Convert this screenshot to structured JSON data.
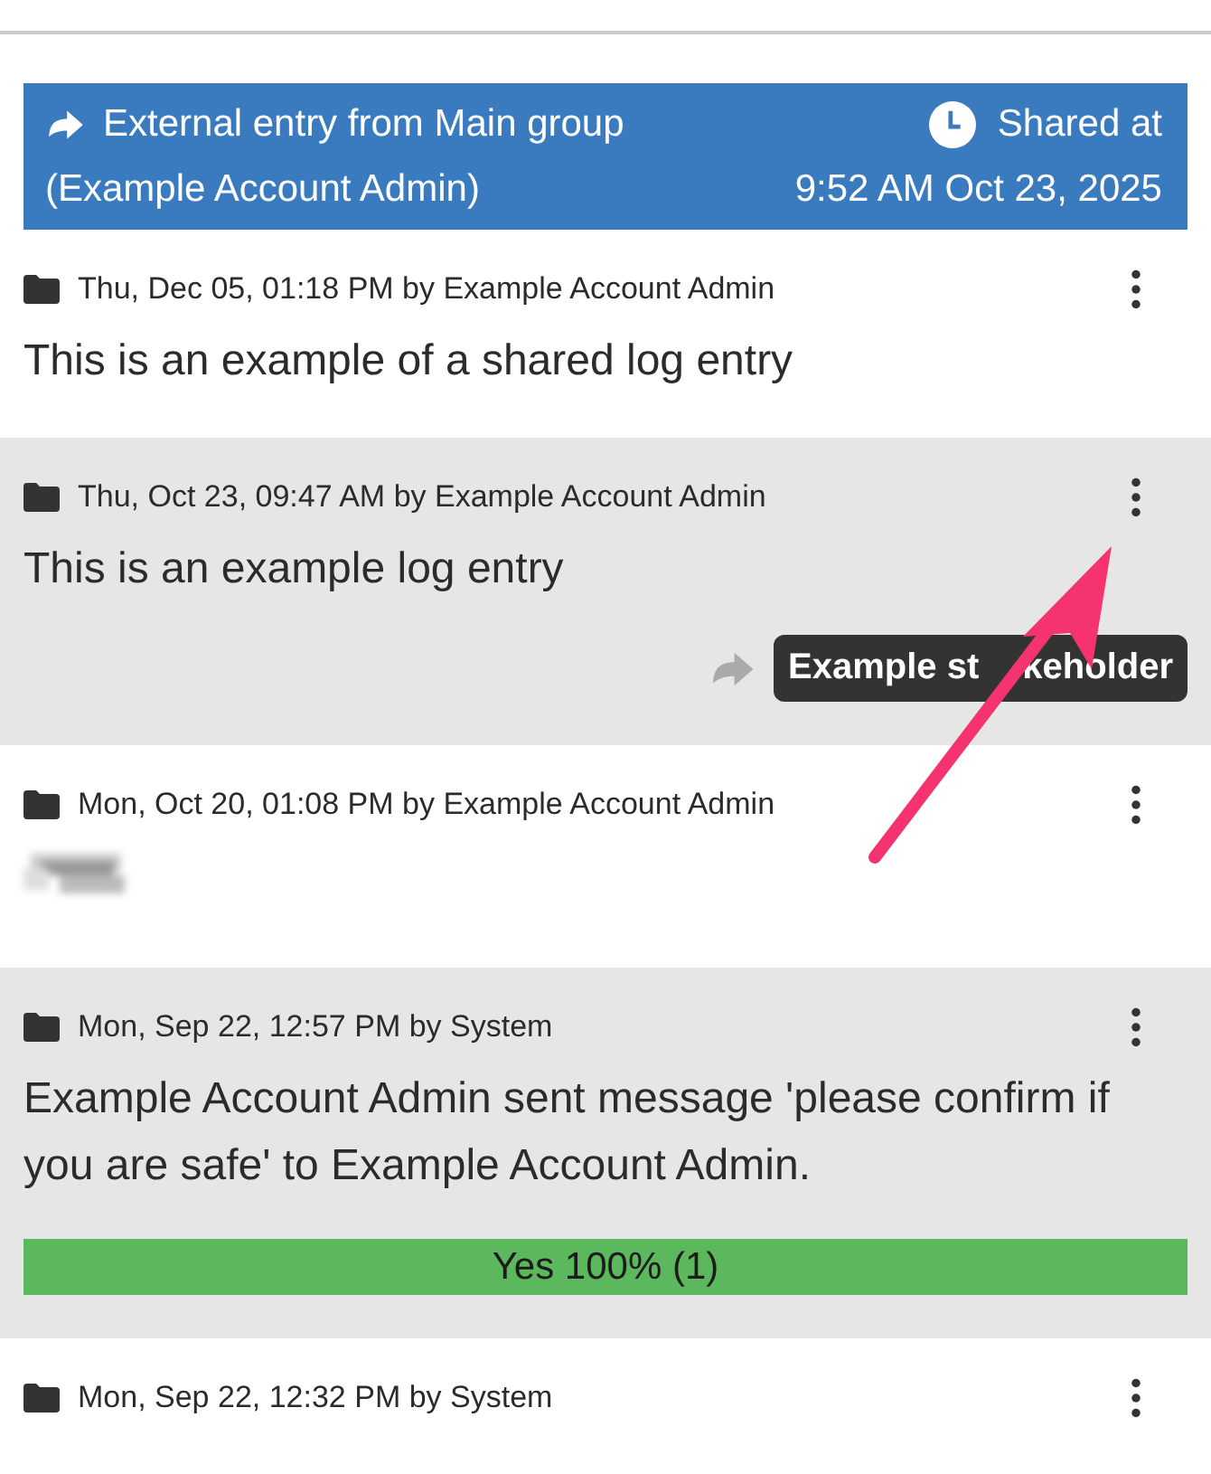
{
  "banner": {
    "source": "External entry from Main group",
    "account": "(Example Account Admin)",
    "shared_label": "Shared at",
    "shared_time": "9:52 AM Oct 23, 2025"
  },
  "entries": [
    {
      "kind": "text",
      "meta": "Thu, Dec 05, 01:18 PM by Example Account Admin",
      "body": "This is an example of a shared log entry"
    },
    {
      "kind": "text",
      "meta": "Thu, Oct 23, 09:47 AM by Example Account Admin",
      "body": "This is an example log entry",
      "shared_to": [
        "Example st",
        "keholder"
      ]
    },
    {
      "kind": "redacted",
      "meta": "Mon, Oct 20, 01:08 PM by Example Account Admin"
    },
    {
      "kind": "poll",
      "meta": "Mon, Sep 22, 12:57 PM by System",
      "body": "Example Account Admin sent message 'please confirm if you are safe' to Example Account Admin.",
      "poll": {
        "label": "Yes 100% (1)",
        "level": 1,
        "color": "#5cb85c"
      }
    },
    {
      "kind": "text",
      "meta": "Mon, Sep 22, 12:32 PM by System"
    }
  ]
}
